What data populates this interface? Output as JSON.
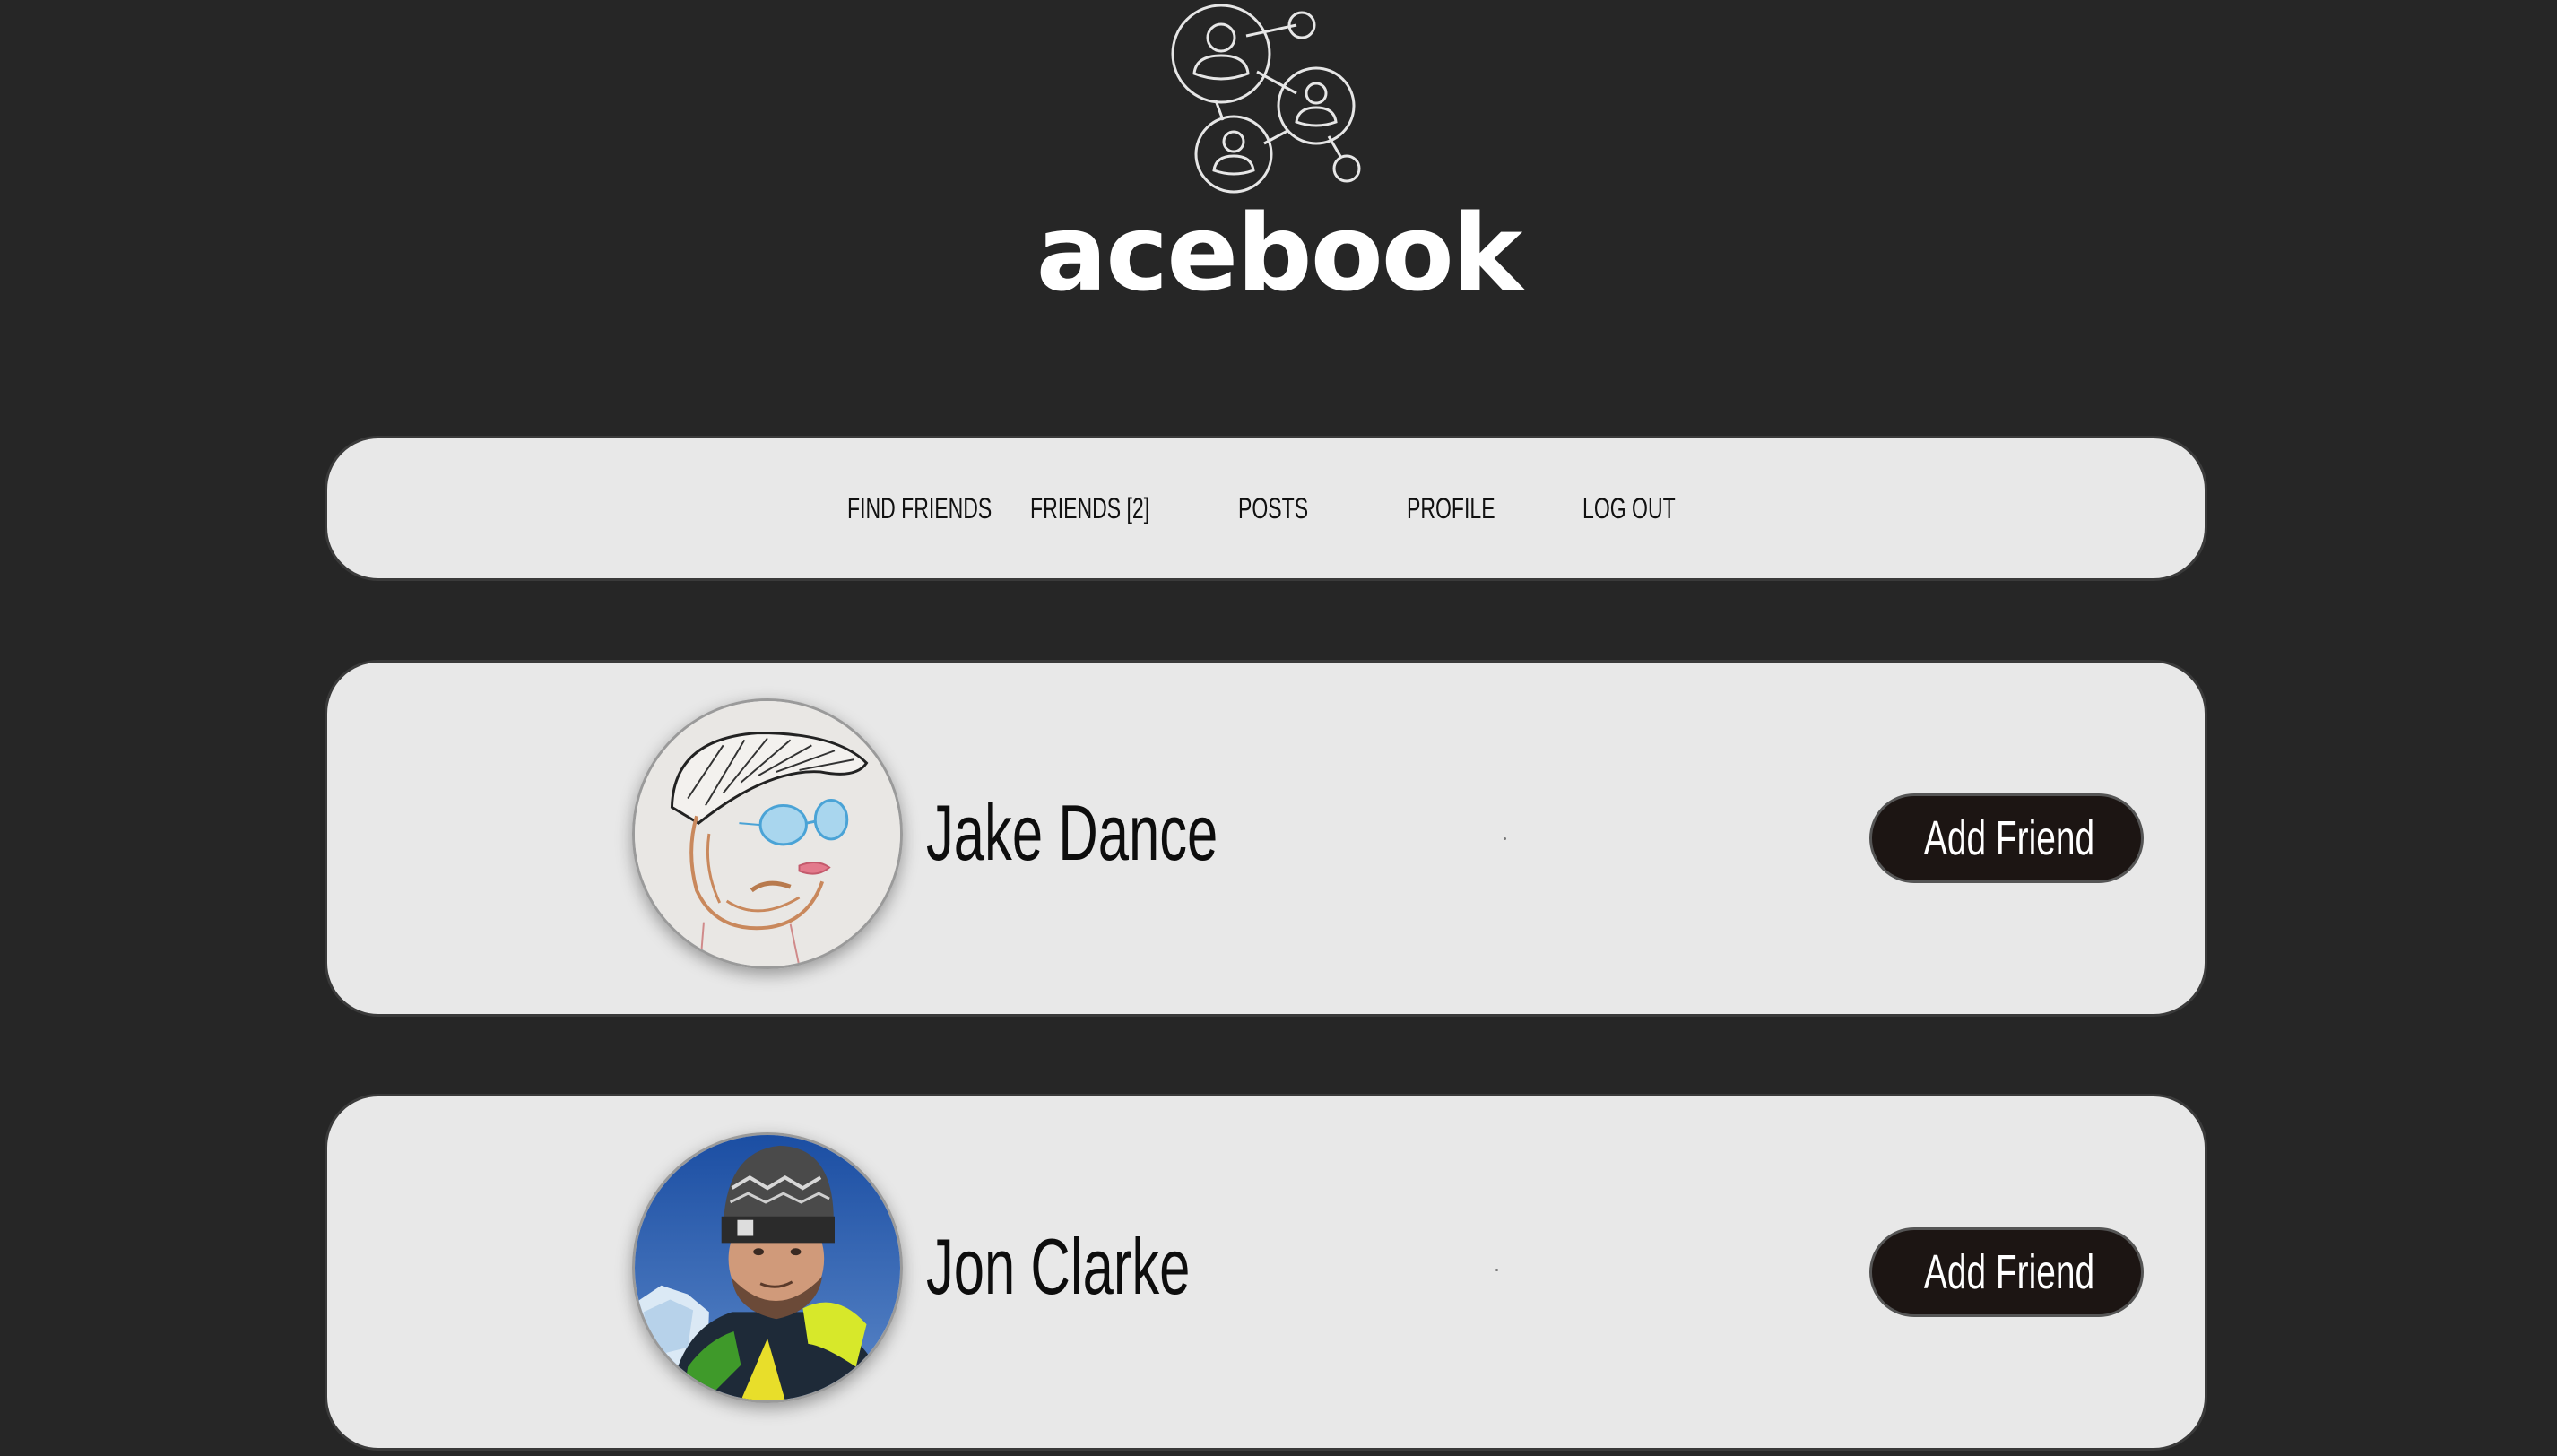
{
  "brand": {
    "title": "acebook",
    "logo_icon": "network-people-icon"
  },
  "nav": {
    "items": [
      {
        "label": "FIND FRIENDS"
      },
      {
        "label": "FRIENDS [2]"
      },
      {
        "label": "POSTS"
      },
      {
        "label": "PROFILE"
      },
      {
        "label": "LOG OUT"
      }
    ]
  },
  "users": [
    {
      "name": "Jake Dance",
      "button_label": "Add Friend",
      "avatar": "sketch-portrait"
    },
    {
      "name": "Jon Clarke",
      "button_label": "Add Friend",
      "avatar": "photo-portrait"
    }
  ],
  "colors": {
    "background": "#262626",
    "card": "#e8e8e8",
    "button": "#1c1513",
    "text_light": "#ffffff"
  }
}
